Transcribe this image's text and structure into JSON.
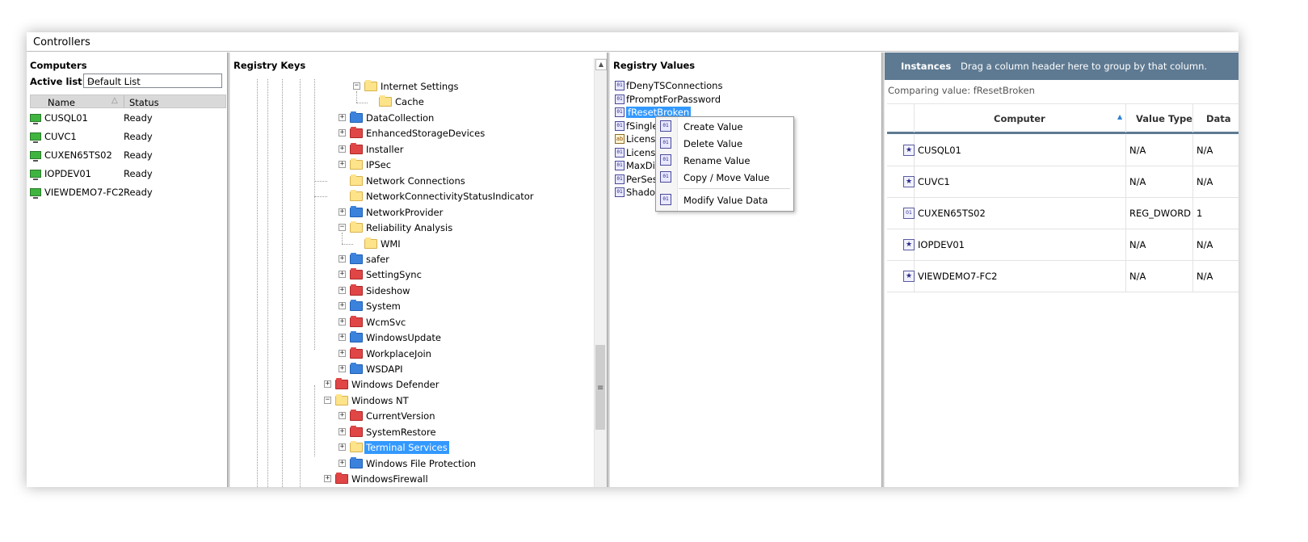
{
  "window": {
    "title": "Controllers"
  },
  "computers": {
    "header": "Computers",
    "active_list_label": "Active list:",
    "active_list_value": "Default List",
    "columns": {
      "name": "Name",
      "status": "Status"
    },
    "rows": [
      {
        "name": "CUSQL01",
        "status": "Ready"
      },
      {
        "name": "CUVC1",
        "status": "Ready"
      },
      {
        "name": "CUXEN65TS02",
        "status": "Ready"
      },
      {
        "name": "IOPDEV01",
        "status": "Ready"
      },
      {
        "name": "VIEWDEMO7-FC2",
        "status": "Ready"
      }
    ]
  },
  "registry_keys": {
    "header": "Registry Keys",
    "items": [
      {
        "label": "Internet Settings",
        "color": "yellow",
        "expander": "minus",
        "selected": false
      },
      {
        "label": "Cache",
        "color": "yellow",
        "expander": "none",
        "selected": false
      },
      {
        "label": "DataCollection",
        "color": "blue",
        "expander": "plus",
        "selected": false
      },
      {
        "label": "EnhancedStorageDevices",
        "color": "red",
        "expander": "plus",
        "selected": false
      },
      {
        "label": "Installer",
        "color": "red",
        "expander": "plus",
        "selected": false
      },
      {
        "label": "IPSec",
        "color": "yellow",
        "expander": "plus",
        "selected": false
      },
      {
        "label": "Network Connections",
        "color": "yellow",
        "expander": "none",
        "selected": false
      },
      {
        "label": "NetworkConnectivityStatusIndicator",
        "color": "yellow",
        "expander": "none",
        "selected": false
      },
      {
        "label": "NetworkProvider",
        "color": "blue",
        "expander": "plus",
        "selected": false
      },
      {
        "label": "Reliability Analysis",
        "color": "yellow",
        "expander": "minus",
        "selected": false
      },
      {
        "label": "WMI",
        "color": "yellow",
        "expander": "none",
        "selected": false
      },
      {
        "label": "safer",
        "color": "blue",
        "expander": "plus",
        "selected": false
      },
      {
        "label": "SettingSync",
        "color": "red",
        "expander": "plus",
        "selected": false
      },
      {
        "label": "Sideshow",
        "color": "red",
        "expander": "plus",
        "selected": false
      },
      {
        "label": "System",
        "color": "blue",
        "expander": "plus",
        "selected": false
      },
      {
        "label": "WcmSvc",
        "color": "red",
        "expander": "plus",
        "selected": false
      },
      {
        "label": "WindowsUpdate",
        "color": "blue",
        "expander": "plus",
        "selected": false
      },
      {
        "label": "WorkplaceJoin",
        "color": "red",
        "expander": "plus",
        "selected": false
      },
      {
        "label": "WSDAPI",
        "color": "blue",
        "expander": "plus",
        "selected": false
      },
      {
        "label": "Windows Defender",
        "color": "red",
        "expander": "plus",
        "selected": false
      },
      {
        "label": "Windows NT",
        "color": "yellow",
        "expander": "minus",
        "selected": false
      },
      {
        "label": "CurrentVersion",
        "color": "red",
        "expander": "plus",
        "selected": false
      },
      {
        "label": "SystemRestore",
        "color": "red",
        "expander": "plus",
        "selected": false
      },
      {
        "label": "Terminal Services",
        "color": "yellow",
        "expander": "plus",
        "selected": true
      },
      {
        "label": "Windows File Protection",
        "color": "blue",
        "expander": "plus",
        "selected": false
      },
      {
        "label": "WindowsFirewall",
        "color": "red",
        "expander": "plus",
        "selected": false
      }
    ]
  },
  "registry_values": {
    "header": "Registry Values",
    "items": [
      {
        "label": "fDenyTSConnections",
        "icon": "dword"
      },
      {
        "label": "fPromptForPassword",
        "icon": "dword"
      },
      {
        "label": "fResetBroken",
        "icon": "dword",
        "selected": true
      },
      {
        "label": "fSingle",
        "icon": "dword"
      },
      {
        "label": "Licens",
        "icon": "string"
      },
      {
        "label": "Licensi",
        "icon": "warning"
      },
      {
        "label": "MaxDis",
        "icon": "warning"
      },
      {
        "label": "PerSes",
        "icon": "dword"
      },
      {
        "label": "Shadow",
        "icon": "dword"
      }
    ],
    "context_menu": [
      {
        "label": "Create Value"
      },
      {
        "label": "Delete Value"
      },
      {
        "label": "Rename Value"
      },
      {
        "label": "Copy / Move Value"
      },
      {
        "label": "Modify Value Data"
      }
    ]
  },
  "instances": {
    "title": "Instances",
    "group_hint": "Drag a column header here to group by that column.",
    "comparing": "Comparing value: fResetBroken",
    "columns": {
      "computer": "Computer",
      "value_type": "Value Type",
      "data": "Data"
    },
    "rows": [
      {
        "computer": "CUSQL01",
        "value_type": "N/A",
        "data": "N/A",
        "icon": "star"
      },
      {
        "computer": "CUVC1",
        "value_type": "N/A",
        "data": "N/A",
        "icon": "star"
      },
      {
        "computer": "CUXEN65TS02",
        "value_type": "REG_DWORD",
        "data": "1",
        "icon": "dword"
      },
      {
        "computer": "IOPDEV01",
        "value_type": "N/A",
        "data": "N/A",
        "icon": "star"
      },
      {
        "computer": "VIEWDEMO7-FC2",
        "value_type": "N/A",
        "data": "N/A",
        "icon": "star"
      }
    ]
  }
}
